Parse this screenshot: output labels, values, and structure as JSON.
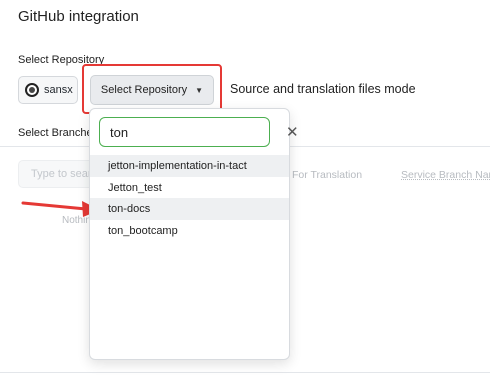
{
  "header": {
    "title": "GitHub integration"
  },
  "repository": {
    "label": "Select Repository",
    "owner": "sansx",
    "select_button_label": "Select Repository",
    "mode_text": "Source and translation files mode"
  },
  "branches": {
    "label": "Select Branches",
    "search_placeholder": "Type to search",
    "col_translation": "For Translation",
    "col_service_branch": "Service Branch Name",
    "empty_text": "Nothing"
  },
  "dropdown": {
    "search_value": "ton",
    "options": [
      {
        "label": "jetton-implementation-in-tact"
      },
      {
        "label": "Jetton_test"
      },
      {
        "label": "ton-docs"
      },
      {
        "label": "ton_bootcamp"
      }
    ]
  },
  "colors": {
    "highlight_border": "#e53935",
    "search_border": "#4caf50",
    "arrow": "#e53935"
  }
}
